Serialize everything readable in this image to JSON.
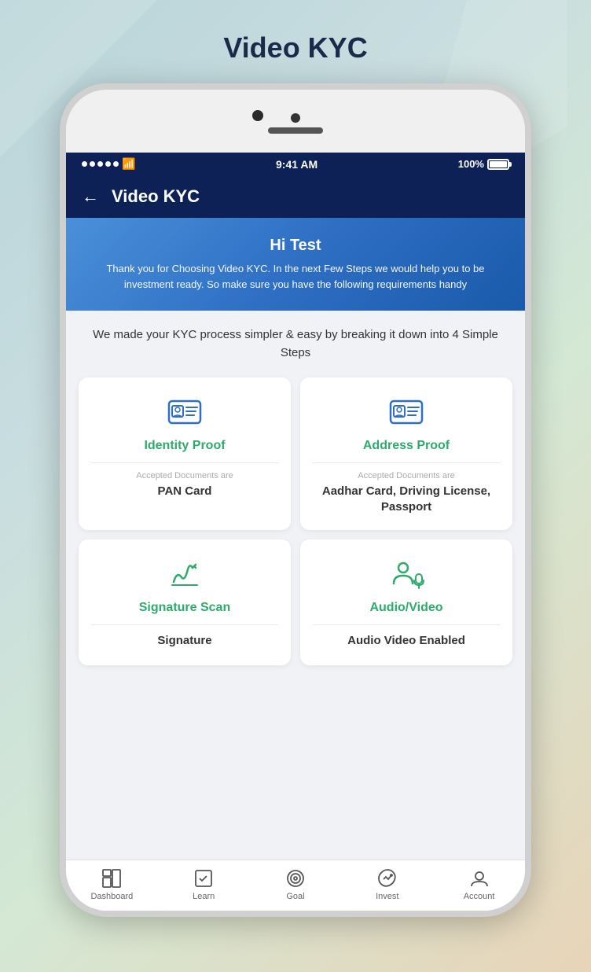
{
  "page": {
    "title": "Video KYC"
  },
  "banner": {
    "greeting": "Hi Test",
    "message": "Thank you for Choosing Video KYC. In the next Few Steps we would help you to be investment ready. So make sure you have the following requirements handy"
  },
  "steps_info": "We made your KYC process simpler & easy by breaking it down into 4 Simple Steps",
  "cards": [
    {
      "id": "identity-proof",
      "title": "Identity Proof",
      "sub_label": "Accepted Documents are",
      "document": "PAN Card"
    },
    {
      "id": "address-proof",
      "title": "Address Proof",
      "sub_label": "Accepted Documents are",
      "document": "Aadhar Card, Driving License, Passport"
    },
    {
      "id": "signature-scan",
      "title": "Signature Scan",
      "sub_label": "",
      "document": "Signature"
    },
    {
      "id": "audio-video",
      "title": "Audio/Video",
      "sub_label": "",
      "document": "Audio Video Enabled"
    }
  ],
  "status_bar": {
    "time": "9:41 AM",
    "battery": "100%"
  },
  "header": {
    "back_label": "←",
    "title": "Video KYC"
  },
  "nav": {
    "items": [
      {
        "label": "Dashboard",
        "icon": "dashboard-icon"
      },
      {
        "label": "Learn",
        "icon": "learn-icon"
      },
      {
        "label": "Goal",
        "icon": "goal-icon"
      },
      {
        "label": "Invest",
        "icon": "invest-icon"
      },
      {
        "label": "Account",
        "icon": "account-icon"
      }
    ]
  }
}
